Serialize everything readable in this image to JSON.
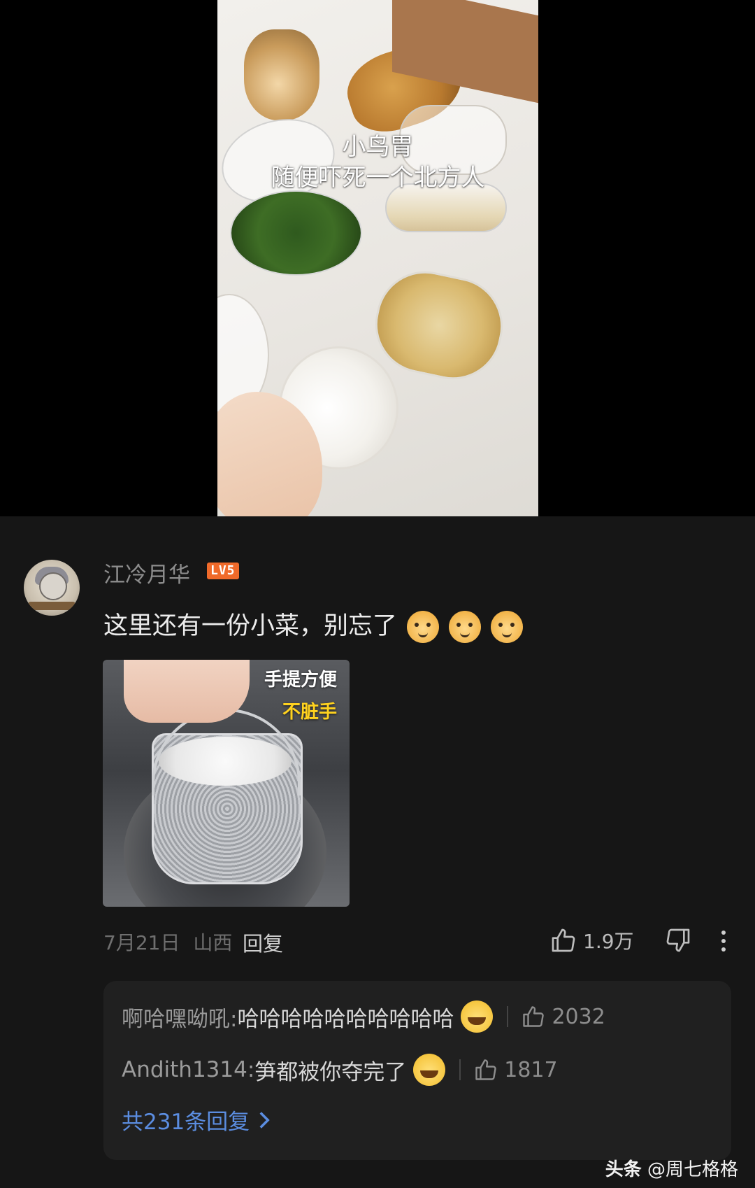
{
  "video": {
    "caption_line1": "小鸟胃",
    "caption_line2": "随便吓死一个北方人"
  },
  "comment": {
    "username": "江冷月华",
    "level": "LV5",
    "text": "这里还有一份小菜，别忘了",
    "image_tags": [
      "手提方便",
      "不脏手"
    ],
    "date": "7月21日",
    "location": "山西",
    "reply_label": "回复",
    "like_count": "1.9万"
  },
  "replies": [
    {
      "author": "啊哈嘿呦吼:",
      "text": " 哈哈哈哈哈哈哈哈哈哈",
      "likes": "2032"
    },
    {
      "author": "Andith1314:",
      "text": " 笋都被你夺完了",
      "likes": "1817"
    }
  ],
  "view_all_label": "共231条回复",
  "watermark": {
    "brand": "头条",
    "handle": "@周七格格"
  },
  "colors": {
    "background": "#161616",
    "accent_link": "#5b8de0",
    "level_badge": "#f06a2a"
  }
}
